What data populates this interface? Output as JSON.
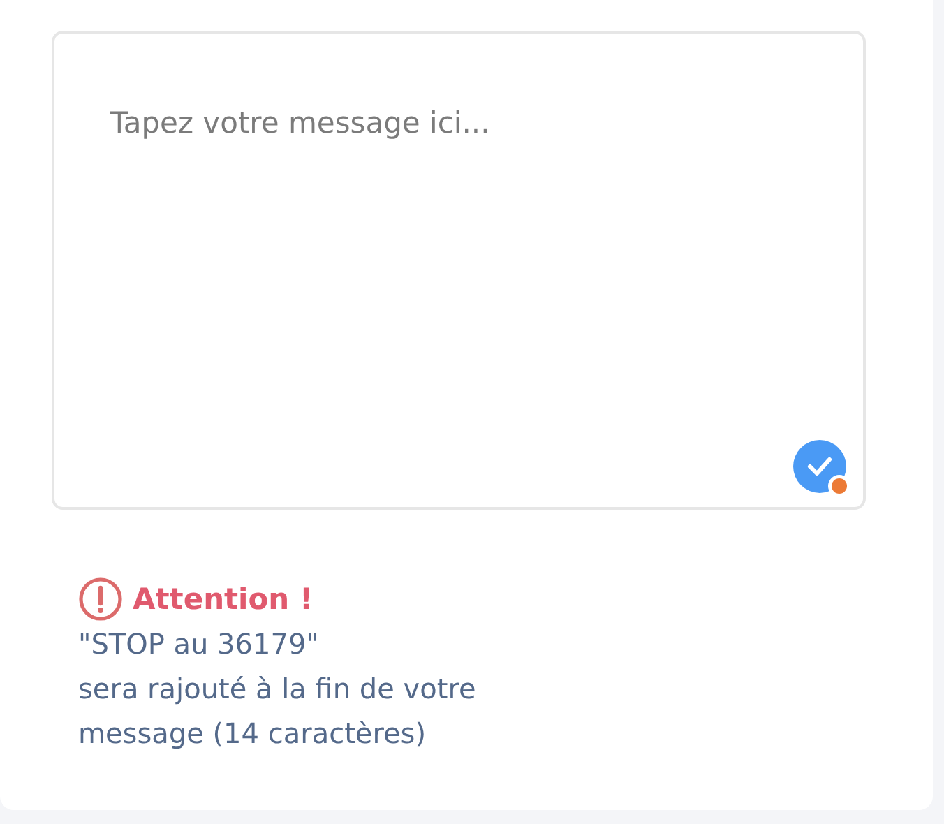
{
  "message": {
    "placeholder": "Tapez votre message ici..."
  },
  "warning": {
    "title": "Attention !",
    "lines": [
      "\"STOP au 36179\"",
      "sera rajouté à la fin de votre",
      "message (14 caractères)"
    ]
  }
}
